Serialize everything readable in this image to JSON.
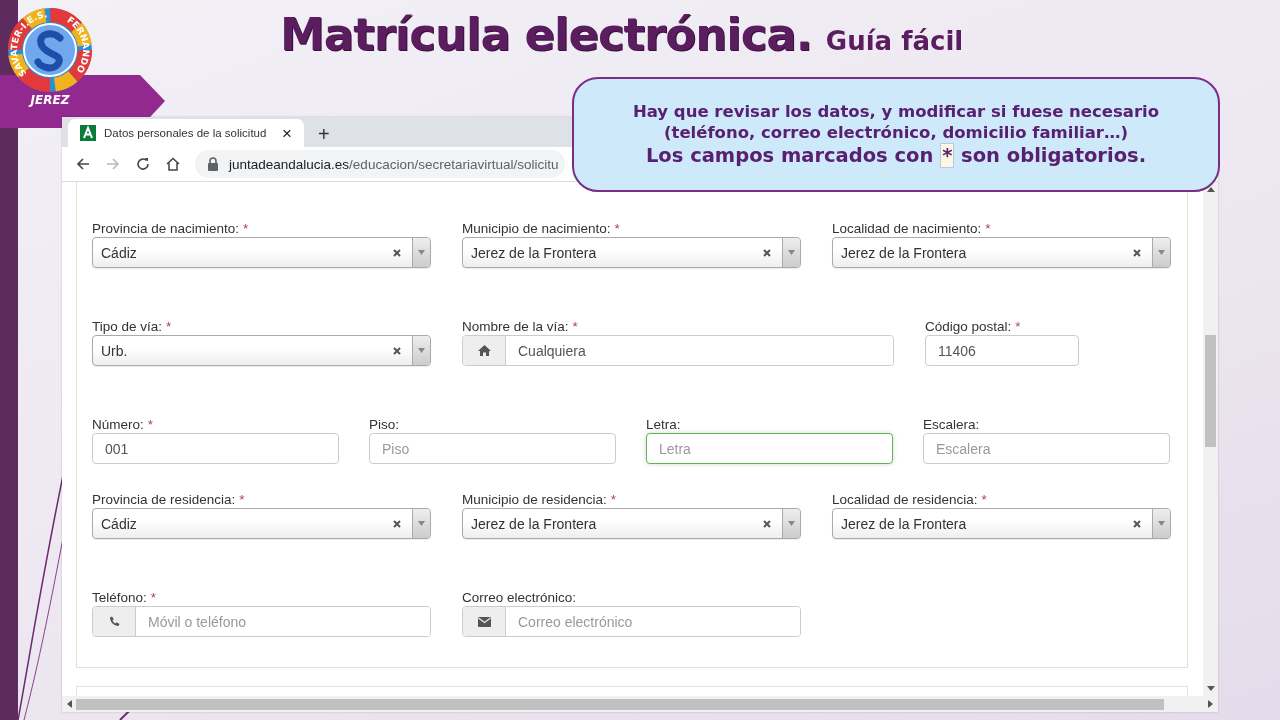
{
  "slide": {
    "title": "Matrícula electrónica.",
    "subtitle": "Guía fácil",
    "logo": {
      "ring_text": [
        "SAVATER-I.E.S.",
        "FERNANDO"
      ],
      "town": "JEREZ"
    }
  },
  "callout": {
    "lines": [
      "Hay que revisar los datos, y modificar si fuese necesario",
      "(teléfono, correo electrónico, domicilio familiar…)"
    ],
    "note_before": "Los campos marcados con",
    "note_mark": "*",
    "note_after": "son obligatorios."
  },
  "browser": {
    "tab": {
      "title": "Datos personales de la solicitud",
      "close": "×"
    },
    "new_tab": "+",
    "back": {
      "disabled": false
    },
    "forward": {
      "disabled": true
    },
    "url_domain": "juntadeandalucia.es",
    "url_path": "/educacion/secretariavirtual/solicitu"
  },
  "form": {
    "rows": [
      {
        "fields": [
          {
            "kind": "select",
            "label": "Provincia de nacimiento:",
            "required_mark": "*",
            "value": "Cádiz"
          },
          {
            "kind": "select",
            "label": "Municipio de nacimiento:",
            "required_mark": "*",
            "value": "Jerez de la Frontera"
          },
          {
            "kind": "select",
            "label": "Localidad de nacimiento:",
            "required_mark": "*",
            "value": "Jerez de la Frontera"
          }
        ]
      },
      {
        "fields": [
          {
            "kind": "select",
            "label": "Tipo de vía:",
            "required_mark": "*",
            "value": "Urb."
          },
          {
            "kind": "home",
            "label": "Nombre de la vía:",
            "required_mark": "*",
            "value": "Cualquiera",
            "focused": false
          },
          {
            "kind": "text",
            "label": "Código postal:",
            "required_mark": "*",
            "value": "11406",
            "focused": false
          }
        ]
      },
      {
        "fields": [
          {
            "kind": "text",
            "label": "Número:",
            "required_mark": "*",
            "value": "001",
            "focused": false
          },
          {
            "kind": "text",
            "label": "Piso:",
            "placeholder": "Piso",
            "focused": false
          },
          {
            "kind": "text",
            "label": "Letra:",
            "placeholder": "Letra",
            "focused": true
          },
          {
            "kind": "text",
            "label": "Escalera:",
            "placeholder": "Escalera",
            "focused": false
          }
        ]
      },
      {
        "fields": [
          {
            "kind": "select",
            "label": "Provincia de residencia:",
            "required_mark": "*",
            "value": "Cádiz"
          },
          {
            "kind": "select",
            "label": "Municipio de residencia:",
            "required_mark": "*",
            "value": "Jerez de la Frontera"
          },
          {
            "kind": "select",
            "label": "Localidad de residencia:",
            "required_mark": "*",
            "value": "Jerez de la Frontera"
          }
        ]
      },
      {
        "fields": [
          {
            "kind": "phone",
            "label": "Teléfono:",
            "required_mark": "*",
            "placeholder": "Móvil o teléfono",
            "focused": false
          },
          {
            "kind": "email",
            "label": "Correo electrónico:",
            "placeholder": "Correo electrónico",
            "focused": false
          }
        ]
      }
    ]
  }
}
